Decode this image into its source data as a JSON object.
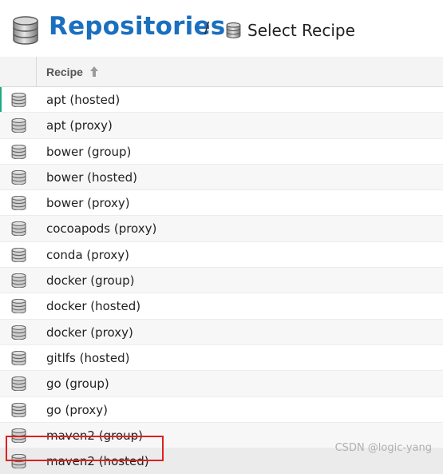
{
  "header": {
    "title": "Repositories",
    "separator": "/",
    "subtitle": "Select Recipe"
  },
  "table": {
    "column_header": "Recipe",
    "sort_icon": "arrow-up-icon",
    "rows": [
      {
        "label": "apt (hosted)"
      },
      {
        "label": "apt (proxy)"
      },
      {
        "label": "bower (group)"
      },
      {
        "label": "bower (hosted)"
      },
      {
        "label": "bower (proxy)"
      },
      {
        "label": "cocoapods (proxy)"
      },
      {
        "label": "conda (proxy)"
      },
      {
        "label": "docker (group)"
      },
      {
        "label": "docker (hosted)"
      },
      {
        "label": "docker (proxy)"
      },
      {
        "label": "gitlfs (hosted)"
      },
      {
        "label": "go (group)"
      },
      {
        "label": "go (proxy)"
      },
      {
        "label": "maven2 (group)"
      },
      {
        "label": "maven2 (hosted)"
      }
    ]
  },
  "watermark": "CSDN @logic-yang",
  "colors": {
    "accent": "#20a882",
    "title": "#1a6fbf",
    "highlight": "#e02020"
  }
}
